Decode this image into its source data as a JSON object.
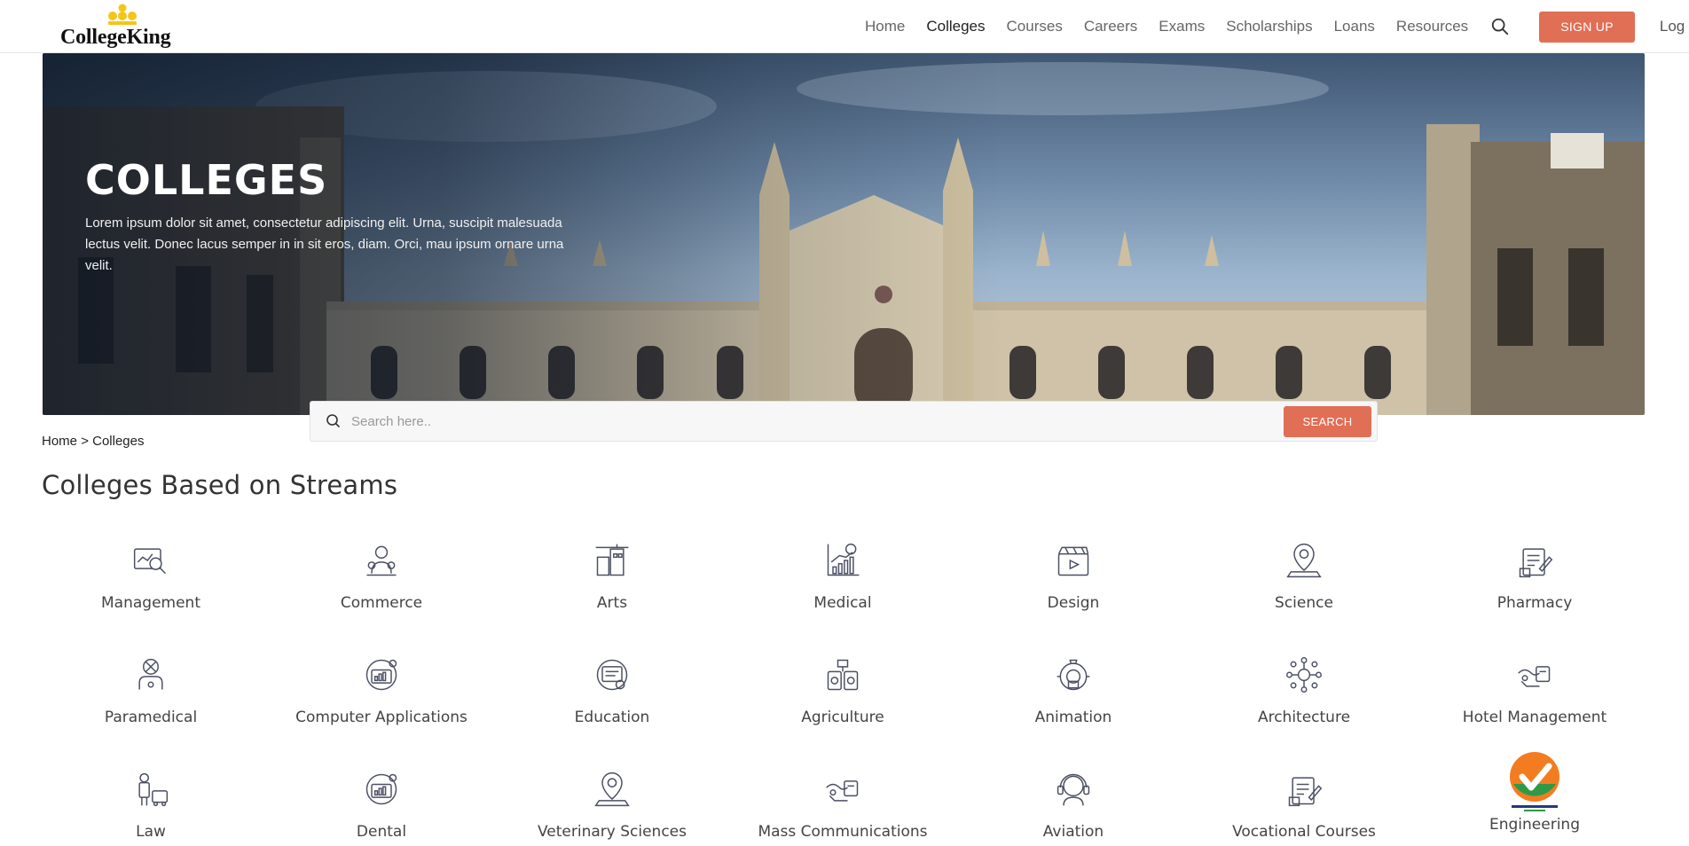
{
  "brand": {
    "name": "CollegeKing"
  },
  "nav": {
    "items": [
      {
        "label": "Home",
        "active": false
      },
      {
        "label": "Colleges",
        "active": true
      },
      {
        "label": "Courses",
        "active": false
      },
      {
        "label": "Careers",
        "active": false
      },
      {
        "label": "Exams",
        "active": false
      },
      {
        "label": "Scholarships",
        "active": false
      },
      {
        "label": "Loans",
        "active": false
      },
      {
        "label": "Resources",
        "active": false
      }
    ],
    "search_icon": "search-icon",
    "signup_label": "SIGN UP",
    "login_label": "Log In"
  },
  "hero": {
    "title": "COLLEGES",
    "description": "Lorem ipsum dolor sit amet, consectetur adipiscing elit. Urna, suscipit malesuada lectus velit. Donec lacus semper in in sit eros, diam. Orci, mau ipsum ornare urna velit."
  },
  "search": {
    "placeholder": "Search here..",
    "button_label": "SEARCH"
  },
  "breadcrumb": {
    "home": "Home",
    "separator": ">",
    "current": "Colleges"
  },
  "streams": {
    "title": "Colleges Based on Streams",
    "items": [
      {
        "label": "Management",
        "icon": "management-icon"
      },
      {
        "label": "Commerce",
        "icon": "commerce-icon"
      },
      {
        "label": "Arts",
        "icon": "arts-icon"
      },
      {
        "label": "Medical",
        "icon": "medical-icon"
      },
      {
        "label": "Design",
        "icon": "design-icon"
      },
      {
        "label": "Science",
        "icon": "science-icon"
      },
      {
        "label": "Pharmacy",
        "icon": "pharmacy-icon"
      },
      {
        "label": "Paramedical",
        "icon": "paramedical-icon"
      },
      {
        "label": "Computer Applications",
        "icon": "computer-applications-icon"
      },
      {
        "label": "Education",
        "icon": "education-icon"
      },
      {
        "label": "Agriculture",
        "icon": "agriculture-icon"
      },
      {
        "label": "Animation",
        "icon": "animation-icon"
      },
      {
        "label": "Architecture",
        "icon": "architecture-icon"
      },
      {
        "label": "Hotel Management",
        "icon": "hotel-management-icon"
      },
      {
        "label": "Law",
        "icon": "law-icon"
      },
      {
        "label": "Dental",
        "icon": "dental-icon"
      },
      {
        "label": "Veterinary Sciences",
        "icon": "veterinary-sciences-icon"
      },
      {
        "label": "Mass Communications",
        "icon": "mass-communications-icon"
      },
      {
        "label": "Aviation",
        "icon": "aviation-icon"
      },
      {
        "label": "Vocational Courses",
        "icon": "vocational-courses-icon"
      },
      {
        "label": "Engineering",
        "icon": "national-testing-agency-logo"
      }
    ]
  },
  "colors": {
    "accent": "#e06f55",
    "icon_stroke": "#4a4f63",
    "nta_orange": "#f47c20",
    "nta_green": "#2e9a47"
  }
}
